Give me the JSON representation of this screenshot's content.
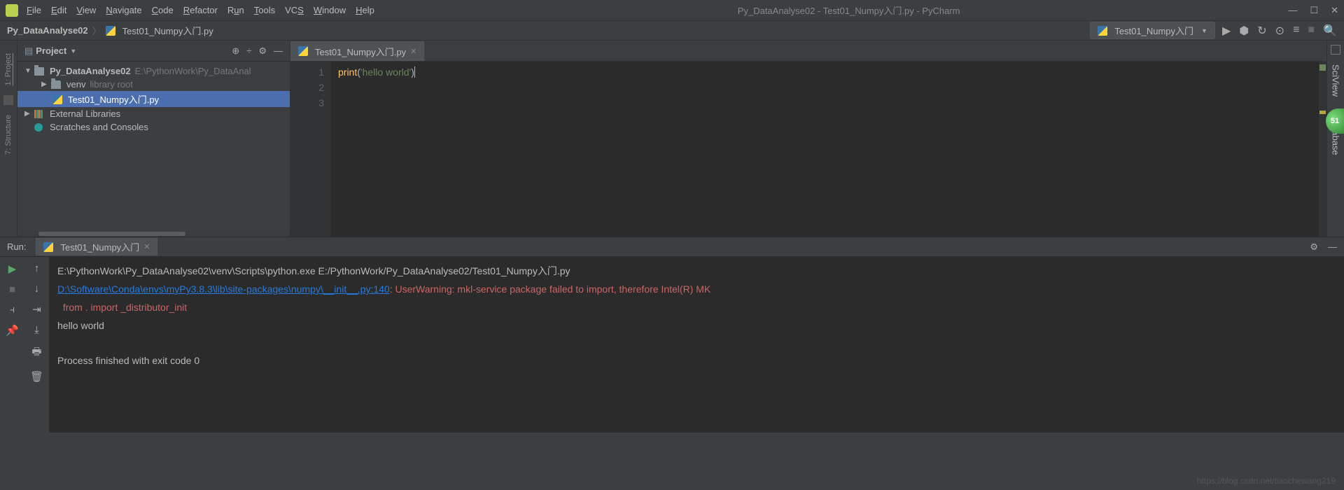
{
  "window": {
    "title": "Py_DataAnalyse02 - Test01_Numpy入门.py - PyCharm"
  },
  "menu": [
    "File",
    "Edit",
    "View",
    "Navigate",
    "Code",
    "Refactor",
    "Run",
    "Tools",
    "VCS",
    "Window",
    "Help"
  ],
  "breadcrumb": {
    "root": "Py_DataAnalyse02",
    "file": "Test01_Numpy入门.py"
  },
  "run_config": {
    "name": "Test01_Numpy入门"
  },
  "left_tabs": {
    "project": "1: Project",
    "structure": "7: Structure"
  },
  "right_tabs": {
    "sciview": "SciView",
    "database": "Database"
  },
  "project_panel": {
    "title": "Project",
    "root": "Py_DataAnalyse02",
    "root_path": "E:\\PythonWork\\Py_DataAnal",
    "venv": "venv",
    "venv_note": "library root",
    "file1": "Test01_Numpy入门.py",
    "ext_lib": "External Libraries",
    "scratches": "Scratches and Consoles"
  },
  "editor": {
    "tab_name": "Test01_Numpy入门.py",
    "lines": [
      "1",
      "2",
      "3"
    ],
    "code": {
      "fn": "print",
      "open": "(",
      "str": "'hello world'",
      "close": ")"
    }
  },
  "orb_value": "51",
  "run_panel": {
    "label": "Run:",
    "tab": "Test01_Numpy入门"
  },
  "console": {
    "cmd": "E:\\PythonWork\\Py_DataAnalyse02\\venv\\Scripts\\python.exe E:/PythonWork/Py_DataAnalyse02/Test01_Numpy入门.py",
    "link": "D:\\Software\\Conda\\envs\\myPy3.8.3\\lib\\site-packages\\numpy\\__init__.py:140",
    "colon": ": ",
    "warn": "UserWarning: mkl-service package failed to import, therefore Intel(R) MK",
    "import_line": "  from . import _distributor_init",
    "output": "hello world",
    "exit": "Process finished with exit code 0"
  },
  "watermark": "https://blog.csdn.net/tiaochewang219"
}
